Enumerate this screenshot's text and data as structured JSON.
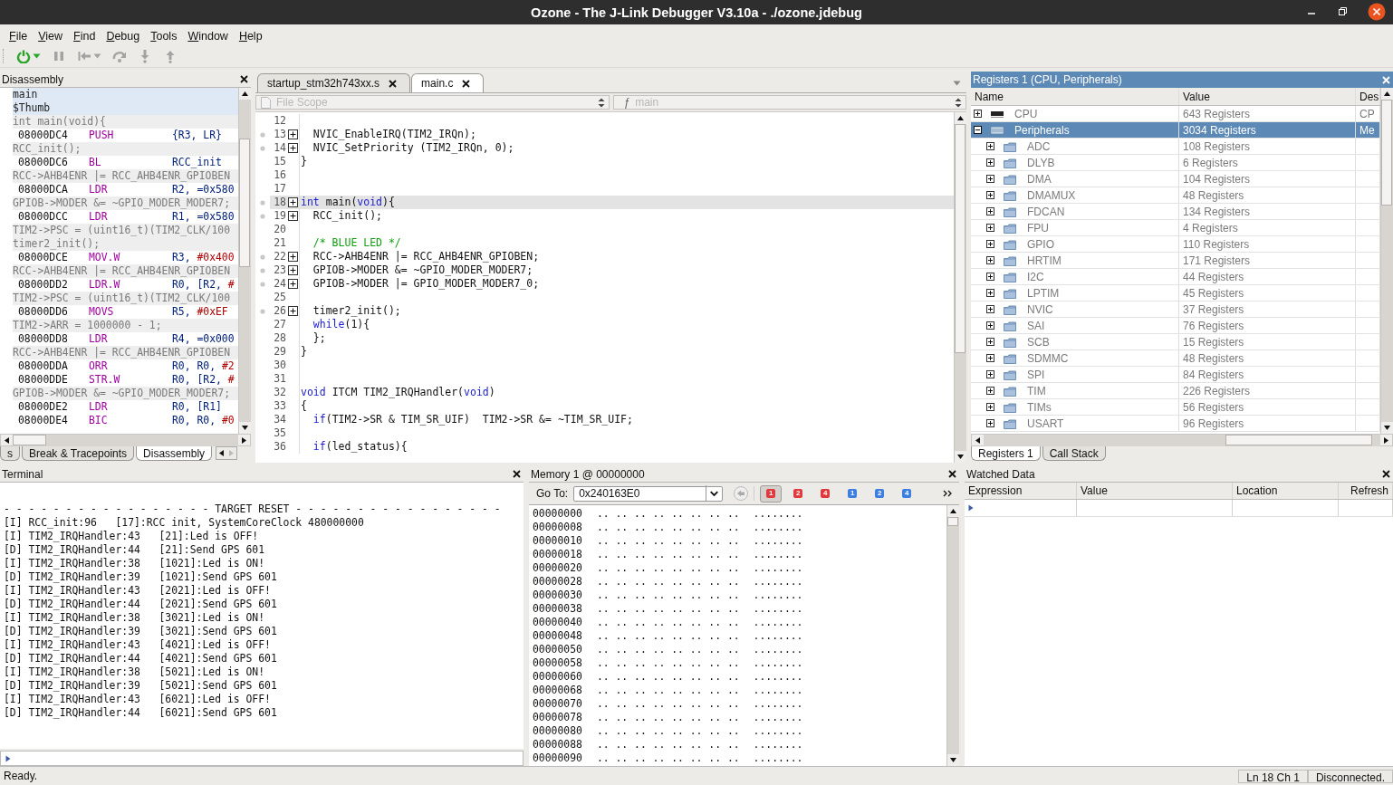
{
  "window": {
    "title": "Ozone - The J-Link Debugger V3.10a - ./ozone.jdebug"
  },
  "menu": [
    "File",
    "View",
    "Find",
    "Debug",
    "Tools",
    "Window",
    "Help"
  ],
  "toolbar": [
    {
      "kind": "power",
      "disabled": false,
      "menu": true
    },
    {
      "kind": "pause",
      "disabled": true,
      "menu": false
    },
    {
      "kind": "step-back",
      "disabled": true,
      "menu": true
    },
    {
      "kind": "step-over",
      "disabled": true,
      "menu": false
    },
    {
      "kind": "step-into",
      "disabled": true,
      "menu": false
    },
    {
      "kind": "step-out",
      "disabled": true,
      "menu": false
    }
  ],
  "disassembly": {
    "title": "Disassembly",
    "lines": [
      {
        "kind": "label",
        "text": "main"
      },
      {
        "kind": "label",
        "text": "$Thumb"
      },
      {
        "kind": "source",
        "text": "int main(void){"
      },
      {
        "kind": "instruction",
        "address": "08000DC4",
        "mnemonic": "PUSH",
        "operands": "{R3, LR}"
      },
      {
        "kind": "source",
        "text": "RCC_init();"
      },
      {
        "kind": "instruction",
        "address": "08000DC6",
        "mnemonic": "BL",
        "operands": "RCC_init"
      },
      {
        "kind": "source",
        "text": "RCC->AHB4ENR |= RCC_AHB4ENR_GPIOBEN"
      },
      {
        "kind": "instruction",
        "address": "08000DCA",
        "mnemonic": "LDR",
        "operands": "R2, =0x580"
      },
      {
        "kind": "source",
        "text": "GPIOB->MODER &= ~GPIO_MODER_MODER7;"
      },
      {
        "kind": "instruction",
        "address": "08000DCC",
        "mnemonic": "LDR",
        "operands": "R1, =0x580"
      },
      {
        "kind": "source",
        "text": "TIM2->PSC = (uint16_t)(TIM2_CLK/100"
      },
      {
        "kind": "source",
        "text": "timer2_init();"
      },
      {
        "kind": "instruction",
        "address": "08000DCE",
        "mnemonic": "MOV.W",
        "operands": "R3, ",
        "immediate": "#0x400"
      },
      {
        "kind": "source",
        "text": "RCC->AHB4ENR |= RCC_AHB4ENR_GPIOBEN"
      },
      {
        "kind": "instruction",
        "address": "08000DD2",
        "mnemonic": "LDR.W",
        "operands": "R0, [R2, ",
        "immediate": "#"
      },
      {
        "kind": "source",
        "text": "TIM2->PSC = (uint16_t)(TIM2_CLK/100"
      },
      {
        "kind": "instruction",
        "address": "08000DD6",
        "mnemonic": "MOVS",
        "operands": "R5, ",
        "immediate": "#0xEF"
      },
      {
        "kind": "source",
        "text": "TIM2->ARR = 1000000 - 1;"
      },
      {
        "kind": "instruction",
        "address": "08000DD8",
        "mnemonic": "LDR",
        "operands": "R4, =0x000"
      },
      {
        "kind": "source",
        "text": "RCC->AHB4ENR |= RCC_AHB4ENR_GPIOBEN"
      },
      {
        "kind": "instruction",
        "address": "08000DDA",
        "mnemonic": "ORR",
        "operands": "R0, R0, ",
        "immediate": "#2"
      },
      {
        "kind": "instruction",
        "address": "08000DDE",
        "mnemonic": "STR.W",
        "operands": "R0, [R2, ",
        "immediate": "#"
      },
      {
        "kind": "source",
        "text": "GPIOB->MODER &= ~GPIO_MODER_MODER7;"
      },
      {
        "kind": "instruction",
        "address": "08000DE2",
        "mnemonic": "LDR",
        "operands": "R0, [R1]"
      },
      {
        "kind": "instruction",
        "address": "08000DE4",
        "mnemonic": "BIC",
        "operands": "R0, R0, ",
        "immediate": "#0"
      }
    ],
    "tabs": [
      {
        "label": "s",
        "selected": false
      },
      {
        "label": "Break & Tracepoints",
        "selected": false
      },
      {
        "label": "Disassembly",
        "selected": true
      }
    ]
  },
  "editor": {
    "tabs": [
      {
        "label": "startup_stm32h743xx.s",
        "selected": false
      },
      {
        "label": "main.c",
        "selected": true
      }
    ],
    "scope": {
      "placeholder": "File Scope"
    },
    "function": {
      "icon": "ƒ",
      "placeholder": "main"
    },
    "lines": [
      {
        "number": "12",
        "fold": false,
        "current": false
      },
      {
        "number": "13",
        "fold": true,
        "current": false,
        "code": [
          {
            "text": "  NVIC_EnableIRQ(TIM2_IRQn);",
            "kind": "plain"
          }
        ]
      },
      {
        "number": "14",
        "fold": true,
        "current": false,
        "code": [
          {
            "text": "  NVIC_SetPriority (TIM2_IRQn, 0);",
            "kind": "plain"
          }
        ]
      },
      {
        "number": "15",
        "fold": false,
        "current": false,
        "code": [
          {
            "text": "}",
            "kind": "plain"
          }
        ]
      },
      {
        "number": "16",
        "fold": false,
        "current": false
      },
      {
        "number": "17",
        "fold": false,
        "current": false
      },
      {
        "number": "18",
        "fold": true,
        "current": true,
        "code": [
          {
            "text": "int",
            "kind": "keyword"
          },
          {
            "text": " main(",
            "kind": "plain"
          },
          {
            "text": "void",
            "kind": "keyword"
          },
          {
            "text": "){",
            "kind": "plain"
          }
        ]
      },
      {
        "number": "19",
        "fold": true,
        "current": false,
        "code": [
          {
            "text": "  RCC_init();",
            "kind": "plain"
          }
        ]
      },
      {
        "number": "20",
        "fold": false,
        "current": false
      },
      {
        "number": "21",
        "fold": false,
        "current": false,
        "code": [
          {
            "text": "  /* BLUE LED */",
            "kind": "comment"
          }
        ]
      },
      {
        "number": "22",
        "fold": true,
        "current": false,
        "code": [
          {
            "text": "  RCC->AHB4ENR |= RCC_AHB4ENR_GPIOBEN;",
            "kind": "plain"
          }
        ]
      },
      {
        "number": "23",
        "fold": true,
        "current": false,
        "code": [
          {
            "text": "  GPIOB->MODER &= ~GPIO_MODER_MODER7;",
            "kind": "plain"
          }
        ]
      },
      {
        "number": "24",
        "fold": true,
        "current": false,
        "code": [
          {
            "text": "  GPIOB->MODER |= GPIO_MODER_MODER7_0;",
            "kind": "plain"
          }
        ]
      },
      {
        "number": "25",
        "fold": false,
        "current": false
      },
      {
        "number": "26",
        "fold": true,
        "current": false,
        "code": [
          {
            "text": "  timer2_init();",
            "kind": "plain"
          }
        ]
      },
      {
        "number": "27",
        "fold": false,
        "current": false,
        "code": [
          {
            "text": "  while",
            "kind": "keyword"
          },
          {
            "text": "(1){",
            "kind": "plain"
          }
        ]
      },
      {
        "number": "28",
        "fold": false,
        "current": false,
        "code": [
          {
            "text": "  };",
            "kind": "plain"
          }
        ]
      },
      {
        "number": "29",
        "fold": false,
        "current": false,
        "code": [
          {
            "text": "}",
            "kind": "plain"
          }
        ]
      },
      {
        "number": "30",
        "fold": false,
        "current": false
      },
      {
        "number": "31",
        "fold": false,
        "current": false
      },
      {
        "number": "32",
        "fold": false,
        "current": false,
        "code": [
          {
            "text": "void",
            "kind": "keyword"
          },
          {
            "text": " ITCM TIM2_IRQHandler(",
            "kind": "plain"
          },
          {
            "text": "void",
            "kind": "keyword"
          },
          {
            "text": ")",
            "kind": "plain"
          }
        ]
      },
      {
        "number": "33",
        "fold": false,
        "current": false,
        "code": [
          {
            "text": "{",
            "kind": "plain"
          }
        ]
      },
      {
        "number": "34",
        "fold": false,
        "current": false,
        "code": [
          {
            "text": "  if",
            "kind": "keyword"
          },
          {
            "text": "(TIM2->SR & TIM_SR_UIF)  TIM2->SR &= ~TIM_SR_UIF;",
            "kind": "plain"
          }
        ]
      },
      {
        "number": "35",
        "fold": false,
        "current": false
      },
      {
        "number": "36",
        "fold": false,
        "current": false,
        "code": [
          {
            "text": "  if",
            "kind": "keyword"
          },
          {
            "text": "(led_status){",
            "kind": "plain"
          }
        ]
      }
    ]
  },
  "registers": {
    "title": "Registers 1 (CPU, Peripherals)",
    "columns": [
      "Name",
      "Value",
      "Des"
    ],
    "rows": [
      {
        "kind": "cpu",
        "name": "CPU",
        "value": "643 Registers",
        "description": "CP",
        "expanded": false,
        "selected": false
      },
      {
        "kind": "peripherals",
        "name": "Peripherals",
        "value": "3034 Registers",
        "description": "Me",
        "expanded": true,
        "selected": true,
        "children": [
          {
            "kind": "group",
            "name": "ADC",
            "value": "108 Registers",
            "expanded": false,
            "selected": false
          },
          {
            "kind": "group",
            "name": "DLYB",
            "value": "6 Registers",
            "expanded": false,
            "selected": false
          },
          {
            "kind": "group",
            "name": "DMA",
            "value": "104 Registers",
            "expanded": false,
            "selected": false
          },
          {
            "kind": "group",
            "name": "DMAMUX",
            "value": "48 Registers",
            "expanded": false,
            "selected": false
          },
          {
            "kind": "group",
            "name": "FDCAN",
            "value": "134 Registers",
            "expanded": false,
            "selected": false
          },
          {
            "kind": "group",
            "name": "FPU",
            "value": "4 Registers",
            "expanded": false,
            "selected": false
          },
          {
            "kind": "group",
            "name": "GPIO",
            "value": "110 Registers",
            "expanded": false,
            "selected": false
          },
          {
            "kind": "group",
            "name": "HRTIM",
            "value": "171 Registers",
            "expanded": false,
            "selected": false
          },
          {
            "kind": "group",
            "name": "I2C",
            "value": "44 Registers",
            "expanded": false,
            "selected": false
          },
          {
            "kind": "group",
            "name": "LPTIM",
            "value": "45 Registers",
            "expanded": false,
            "selected": false
          },
          {
            "kind": "group",
            "name": "NVIC",
            "value": "37 Registers",
            "expanded": false,
            "selected": false
          },
          {
            "kind": "group",
            "name": "SAI",
            "value": "76 Registers",
            "expanded": false,
            "selected": false
          },
          {
            "kind": "group",
            "name": "SCB",
            "value": "15 Registers",
            "expanded": false,
            "selected": false
          },
          {
            "kind": "group",
            "name": "SDMMC",
            "value": "48 Registers",
            "expanded": false,
            "selected": false
          },
          {
            "kind": "group",
            "name": "SPI",
            "value": "84 Registers",
            "expanded": false,
            "selected": false
          },
          {
            "kind": "group",
            "name": "TIM",
            "value": "226 Registers",
            "expanded": false,
            "selected": false
          },
          {
            "kind": "group",
            "name": "TIMs",
            "value": "56 Registers",
            "expanded": false,
            "selected": false
          },
          {
            "kind": "group",
            "name": "USART",
            "value": "96 Registers",
            "expanded": false,
            "selected": false
          }
        ]
      }
    ],
    "tabs": [
      {
        "label": "Registers 1",
        "selected": true
      },
      {
        "label": "Call Stack",
        "selected": false
      }
    ]
  },
  "terminal": {
    "title": "Terminal",
    "lines": [
      "- - - - - - - - - - - - - - - - - TARGET RESET - - - - - - - - - - - - - - - - -",
      "[I] RCC_init:96   [17]:RCC init, SystemCoreClock 480000000",
      "[I] TIM2_IRQHandler:43   [21]:Led is OFF!",
      "[D] TIM2_IRQHandler:44   [21]:Send GPS 601",
      "[I] TIM2_IRQHandler:38   [1021]:Led is ON!",
      "[D] TIM2_IRQHandler:39   [1021]:Send GPS 601",
      "[I] TIM2_IRQHandler:43   [2021]:Led is OFF!",
      "[D] TIM2_IRQHandler:44   [2021]:Send GPS 601",
      "[I] TIM2_IRQHandler:38   [3021]:Led is ON!",
      "[D] TIM2_IRQHandler:39   [3021]:Send GPS 601",
      "[I] TIM2_IRQHandler:43   [4021]:Led is OFF!",
      "[D] TIM2_IRQHandler:44   [4021]:Send GPS 601",
      "[I] TIM2_IRQHandler:38   [5021]:Led is ON!",
      "[D] TIM2_IRQHandler:39   [5021]:Send GPS 601",
      "[I] TIM2_IRQHandler:43   [6021]:Led is OFF!",
      "[D] TIM2_IRQHandler:44   [6021]:Send GPS 601"
    ]
  },
  "memory": {
    "title": "Memory 1 @ 00000000",
    "goto_label": "Go To:",
    "address": "0x240163E0",
    "breakpoints": [
      {
        "label": "1",
        "color": "#e0393e",
        "selected": true
      },
      {
        "label": "2",
        "color": "#e0393e",
        "selected": false
      },
      {
        "label": "4",
        "color": "#e0393e",
        "selected": false
      },
      {
        "label": "1",
        "color": "#3d7fe0",
        "selected": false
      },
      {
        "label": "2",
        "color": "#3d7fe0",
        "selected": false
      },
      {
        "label": "4",
        "color": "#3d7fe0",
        "selected": false
      }
    ],
    "rows": [
      {
        "address": "00000000",
        "bytes": ".. .. .. .. .. .. .. ..",
        "ascii": "........"
      },
      {
        "address": "00000008",
        "bytes": ".. .. .. .. .. .. .. ..",
        "ascii": "........"
      },
      {
        "address": "00000010",
        "bytes": ".. .. .. .. .. .. .. ..",
        "ascii": "........"
      },
      {
        "address": "00000018",
        "bytes": ".. .. .. .. .. .. .. ..",
        "ascii": "........"
      },
      {
        "address": "00000020",
        "bytes": ".. .. .. .. .. .. .. ..",
        "ascii": "........"
      },
      {
        "address": "00000028",
        "bytes": ".. .. .. .. .. .. .. ..",
        "ascii": "........"
      },
      {
        "address": "00000030",
        "bytes": ".. .. .. .. .. .. .. ..",
        "ascii": "........"
      },
      {
        "address": "00000038",
        "bytes": ".. .. .. .. .. .. .. ..",
        "ascii": "........"
      },
      {
        "address": "00000040",
        "bytes": ".. .. .. .. .. .. .. ..",
        "ascii": "........"
      },
      {
        "address": "00000048",
        "bytes": ".. .. .. .. .. .. .. ..",
        "ascii": "........"
      },
      {
        "address": "00000050",
        "bytes": ".. .. .. .. .. .. .. ..",
        "ascii": "........"
      },
      {
        "address": "00000058",
        "bytes": ".. .. .. .. .. .. .. ..",
        "ascii": "........"
      },
      {
        "address": "00000060",
        "bytes": ".. .. .. .. .. .. .. ..",
        "ascii": "........"
      },
      {
        "address": "00000068",
        "bytes": ".. .. .. .. .. .. .. ..",
        "ascii": "........"
      },
      {
        "address": "00000070",
        "bytes": ".. .. .. .. .. .. .. ..",
        "ascii": "........"
      },
      {
        "address": "00000078",
        "bytes": ".. .. .. .. .. .. .. ..",
        "ascii": "........"
      },
      {
        "address": "00000080",
        "bytes": ".. .. .. .. .. .. .. ..",
        "ascii": "........"
      },
      {
        "address": "00000088",
        "bytes": ".. .. .. .. .. .. .. ..",
        "ascii": "........"
      },
      {
        "address": "00000090",
        "bytes": ".. .. .. .. .. .. .. ..",
        "ascii": "........"
      }
    ]
  },
  "watched": {
    "title": "Watched Data",
    "columns": [
      "Expression",
      "Value",
      "Location",
      "Refresh"
    ]
  },
  "status_bar": {
    "message": "Ready.",
    "position": "Ln 18  Ch 1",
    "connection": "Disconnected."
  }
}
